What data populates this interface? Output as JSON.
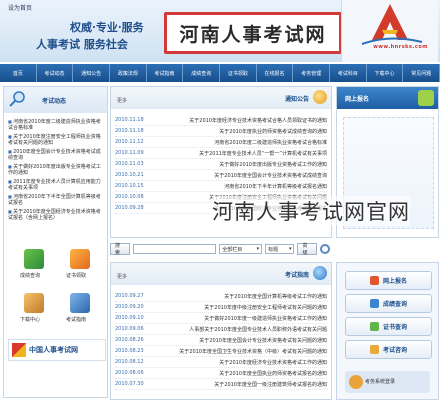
{
  "header": {
    "top_link": "设为首页",
    "site_title": "河南人事考试网",
    "slogan_line1": "权威·专业·服务",
    "slogan_line2": "人事考试 服务社会",
    "logo_caption": "www.hnrsks.com"
  },
  "nav": {
    "items": [
      "首页",
      "考试动态",
      "通知公告",
      "政策法规",
      "考试指南",
      "成绩查询",
      "证书领取",
      "在线报名",
      "考务管理",
      "考试科目",
      "下载中心",
      "常见问题"
    ]
  },
  "left": {
    "title": "考试动态",
    "items": [
      "河南省2010年度二级建造师执业资格考试合格标准",
      "关于2010年度注册安全工程师执业资格考试有关问题的通知",
      "2010年度全国会计专业技术资格考试成绩查询",
      "关于做好2010年度出版专业资格考试工作的通知",
      "2011年度专业技术人员计算机应用能力考试有关事项",
      "河南省2010年下半年全国计算机等级考试报名",
      "关于2010年度全国经济专业技术资格考试报名（含网上报名）"
    ],
    "icons": {
      "top_left": "成绩查询",
      "top_right": "证书领取",
      "bottom_left": "下载中心",
      "bottom_right": "考试指南"
    },
    "banner_text": "中国人事考试网"
  },
  "news": {
    "more": "更多",
    "title": "通知公告",
    "rows": [
      {
        "date": "2010.11.18",
        "text": "关于2010年度经济专业技术资格考试合格人员领取证书的通知"
      },
      {
        "date": "2010.11.18",
        "text": "关于2010年度执业药师资格考试成绩查询的通知"
      },
      {
        "date": "2010.11.12",
        "text": "河南省2010年度二级建造师执业资格考试合格标准"
      },
      {
        "date": "2010.11.09",
        "text": "关于2011年度专业技术人员“一帮一”计算机考试有关事项"
      },
      {
        "date": "2010.11.03",
        "text": "关于做好2010年度出版专业资格考试工作的通知"
      },
      {
        "date": "2010.10.21",
        "text": "关于2010年度全国会计专业技术资格考试成绩查询"
      },
      {
        "date": "2010.10.15",
        "text": "河南省2010年下半年计算机等级考试报名通知"
      },
      {
        "date": "2010.10.08",
        "text": "关于2010年度注册安全工程师执业资格考试有关问题"
      },
      {
        "date": "2010.09.28",
        "text": "关于2010年度全国经济专业技术资格考试网上报名"
      }
    ]
  },
  "search": {
    "button1": "搜索",
    "select1": "全部栏目",
    "select2": "标题",
    "button2": "高级"
  },
  "exams": {
    "more": "更多",
    "title": "考试指南",
    "rows": [
      {
        "date": "2010.09.27",
        "text": "关于2010年度全国计算机等级考试工作的通知"
      },
      {
        "date": "2010.09.20",
        "text": "关于2010年度中级注册安全工程师考试有关问题的通知"
      },
      {
        "date": "2010.09.10",
        "text": "关于做好2010年度一级建造师执业资格考试工作的通知"
      },
      {
        "date": "2010.09.06",
        "text": "人事部关于2010年度全国专业技术人员职称外语考试有关问题"
      },
      {
        "date": "2010.08.26",
        "text": "关于2010年度全国会计专业技术资格考试有关问题的通知"
      },
      {
        "date": "2010.08.23",
        "text": "关于2010年度全国卫生专业技术资格（中级）考试有关问题的通知"
      },
      {
        "date": "2010.08.12",
        "text": "关于2010年度经济专业技术资格考试工作的通知"
      },
      {
        "date": "2010.08.06",
        "text": "关于2010年度全国执业药师资格考试报名的通知"
      },
      {
        "date": "2010.07.30",
        "text": "关于2010年度全国一级注册建筑师考试报名的通知"
      }
    ]
  },
  "right": {
    "title": "网上报名",
    "buttons": [
      "网上报名",
      "成绩查询",
      "证书查询",
      "考试咨询"
    ],
    "footer": "考务系统登录"
  },
  "watermark": "河南人事考试网官网"
}
